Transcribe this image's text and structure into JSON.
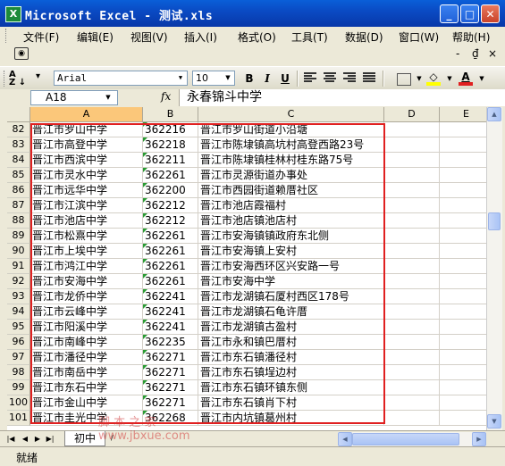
{
  "window": {
    "title": "Microsoft Excel - 测试.xls",
    "app_icon": "excel-icon",
    "buttons": {
      "minimize": "_",
      "maximize": "□",
      "close": "✕"
    }
  },
  "menu": {
    "items": [
      "文件(F)",
      "编辑(E)",
      "视图(V)",
      "插入(I)",
      "格式(O)",
      "工具(T)",
      "数据(D)",
      "窗口(W)",
      "帮助(H)"
    ],
    "doc_controls": [
      "-",
      "₫",
      "×"
    ]
  },
  "format_toolbar": {
    "font": "Arial",
    "size": "10",
    "bold": "B",
    "italic": "I",
    "underline": "U",
    "font_color_accent": "#e02020",
    "fill_color_accent": "#ffff00"
  },
  "formula_bar": {
    "name_box": "A18",
    "fx": "fx",
    "content": "永春锦斗中学"
  },
  "grid": {
    "columns": [
      "A",
      "B",
      "C",
      "D",
      "E"
    ],
    "rows": [
      {
        "n": "82",
        "a": "晋江市罗山中学",
        "b": "362216",
        "c": "晋江市罗山街道小沿塘"
      },
      {
        "n": "83",
        "a": "晋江市高登中学",
        "b": "362218",
        "c": "晋江市陈埭镇高坑村高登西路23号"
      },
      {
        "n": "84",
        "a": "晋江市西滨中学",
        "b": "362211",
        "c": "晋江市陈埭镇桂林村桂东路75号"
      },
      {
        "n": "85",
        "a": "晋江市灵水中学",
        "b": "362261",
        "c": "晋江市灵源街道办事处"
      },
      {
        "n": "86",
        "a": "晋江市远华中学",
        "b": "362200",
        "c": "晋江市西园街道赖厝社区"
      },
      {
        "n": "87",
        "a": "晋江市江滨中学",
        "b": "362212",
        "c": "晋江市池店霞福村"
      },
      {
        "n": "88",
        "a": "晋江市池店中学",
        "b": "362212",
        "c": "晋江市池店镇池店村"
      },
      {
        "n": "89",
        "a": "晋江市松熹中学",
        "b": "362261",
        "c": "晋江市安海镇镇政府东北侧"
      },
      {
        "n": "90",
        "a": "晋江市上埃中学",
        "b": "362261",
        "c": "晋江市安海镇上安村"
      },
      {
        "n": "91",
        "a": "晋江市鸿江中学",
        "b": "362261",
        "c": "晋江市安海西环区兴安路一号"
      },
      {
        "n": "92",
        "a": "晋江市安海中学",
        "b": "362261",
        "c": "晋江市安海中学"
      },
      {
        "n": "93",
        "a": "晋江市龙侨中学",
        "b": "362241",
        "c": "晋江市龙湖镇石厦村西区178号"
      },
      {
        "n": "94",
        "a": "晋江市云峰中学",
        "b": "362241",
        "c": "晋江市龙湖镇石龟许厝"
      },
      {
        "n": "95",
        "a": "晋江市阳溪中学",
        "b": "362241",
        "c": "晋江市龙湖镇古盈村"
      },
      {
        "n": "96",
        "a": "晋江市南峰中学",
        "b": "362235",
        "c": "晋江市永和镇巴厝村"
      },
      {
        "n": "97",
        "a": "晋江市潘径中学",
        "b": "362271",
        "c": "晋江市东石镇潘径村"
      },
      {
        "n": "98",
        "a": "晋江市南岳中学",
        "b": "362271",
        "c": "晋江市东石镇埕边村"
      },
      {
        "n": "99",
        "a": "晋江市东石中学",
        "b": "362271",
        "c": "晋江市东石镇环镇东侧"
      },
      {
        "n": "100",
        "a": "晋江市金山中学",
        "b": "362271",
        "c": "晋江市东石镇肖下村"
      },
      {
        "n": "101",
        "a": "晋江市圭光中学",
        "b": "362268",
        "c": "晋江市内坑镇葛州村"
      }
    ]
  },
  "sheet_tabs": {
    "active": "初中"
  },
  "watermark": {
    "line1": "脚 本 之 家",
    "line2": "www.jbxue.com"
  },
  "status": {
    "text": "就绪"
  },
  "colors": {
    "selection_highlight": "#fbc77a",
    "callout_box": "#e02020",
    "number_flag": "#2a9b34"
  }
}
